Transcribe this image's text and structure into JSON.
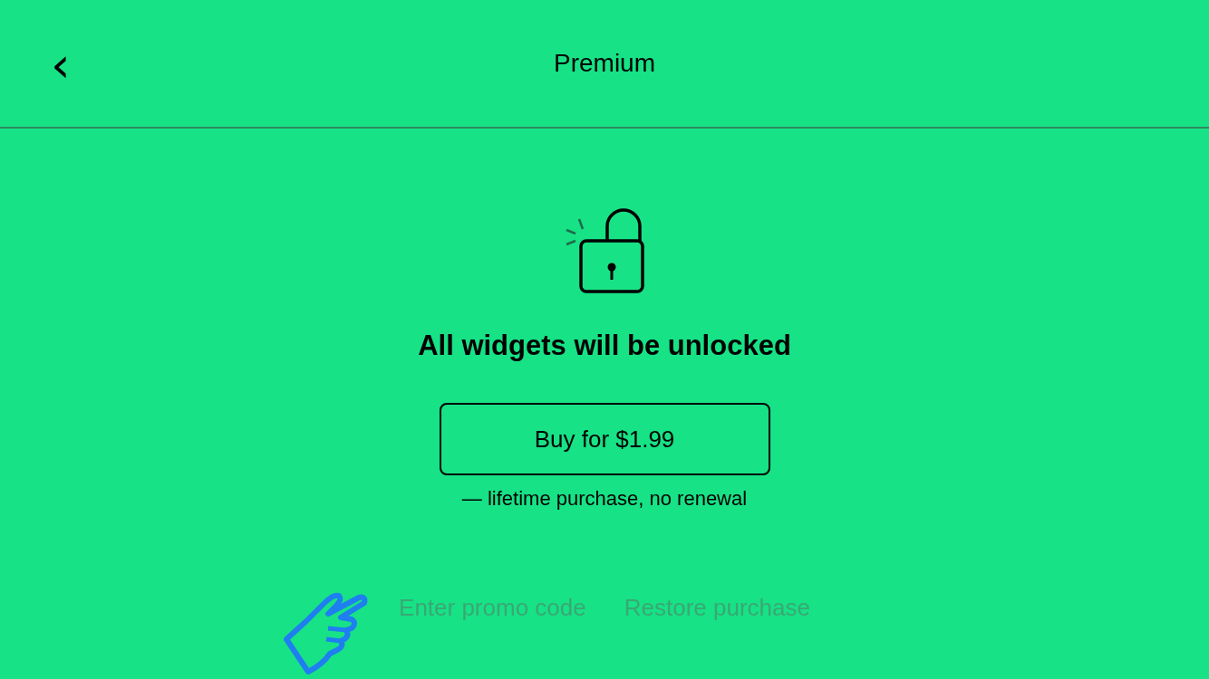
{
  "header": {
    "back": "‹",
    "title": "Premium"
  },
  "headline": "All widgets will be unlocked",
  "buy_button": "Buy for $1.99",
  "note": "— lifetime purchase, no renewal",
  "links": [
    "Enter promo code",
    "Restore purchase"
  ]
}
